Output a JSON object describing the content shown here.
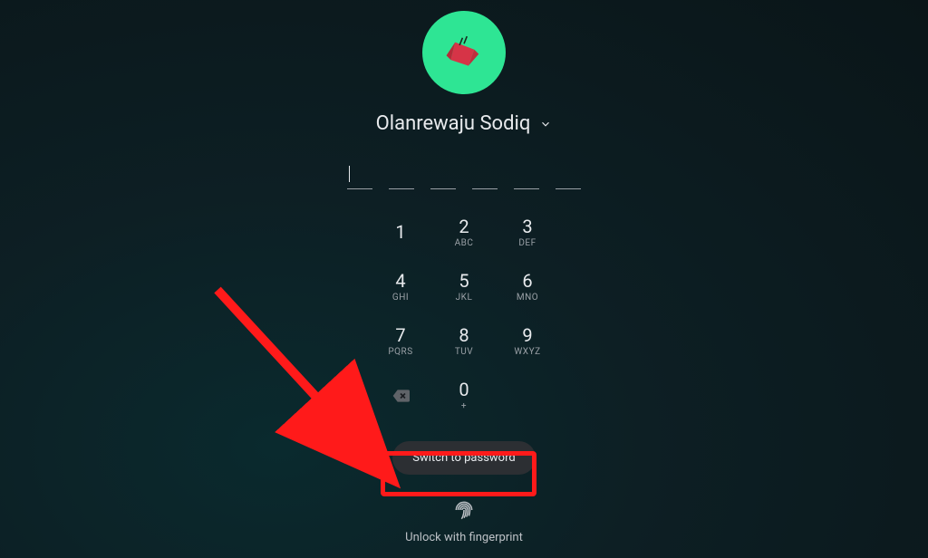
{
  "user": {
    "name": "Olanrewaju Sodiq"
  },
  "pin": {
    "length": 6,
    "active_index": 0
  },
  "keypad": [
    {
      "digit": "1",
      "letters": ""
    },
    {
      "digit": "2",
      "letters": "ABC"
    },
    {
      "digit": "3",
      "letters": "DEF"
    },
    {
      "digit": "4",
      "letters": "GHI"
    },
    {
      "digit": "5",
      "letters": "JKL"
    },
    {
      "digit": "6",
      "letters": "MNO"
    },
    {
      "digit": "7",
      "letters": "PQRS"
    },
    {
      "digit": "8",
      "letters": "TUV"
    },
    {
      "digit": "9",
      "letters": "WXYZ"
    }
  ],
  "zero_key": {
    "digit": "0",
    "letters": "+"
  },
  "switch_button": "Switch to password",
  "fingerprint_hint": "Unlock with fingerprint",
  "annotation": {
    "arrow_color": "#ff1a1a",
    "highlight_color": "#ff1a1a"
  }
}
